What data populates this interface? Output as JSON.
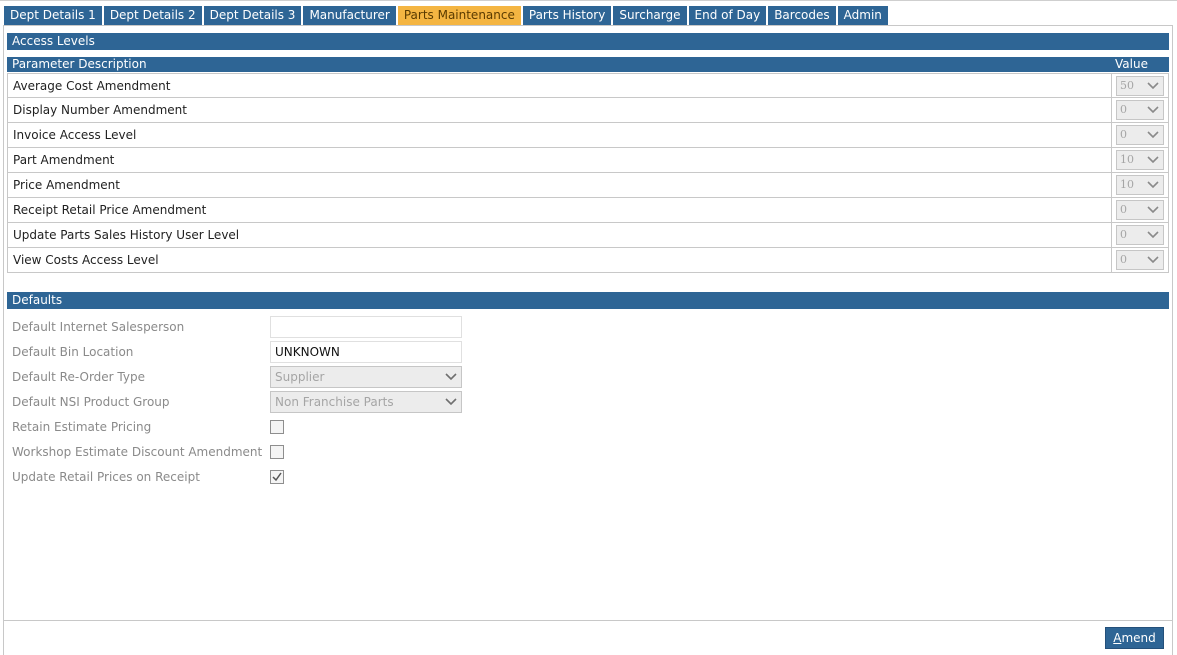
{
  "tabs": [
    {
      "label": "Dept Details 1",
      "active": false
    },
    {
      "label": "Dept Details 2",
      "active": false
    },
    {
      "label": "Dept Details 3",
      "active": false
    },
    {
      "label": "Manufacturer",
      "active": false
    },
    {
      "label": "Parts Maintenance",
      "active": true
    },
    {
      "label": "Parts History",
      "active": false
    },
    {
      "label": "Surcharge",
      "active": false
    },
    {
      "label": "End of Day",
      "active": false
    },
    {
      "label": "Barcodes",
      "active": false
    },
    {
      "label": "Admin",
      "active": false
    }
  ],
  "access_levels": {
    "title": "Access Levels",
    "columns": {
      "description": "Parameter Description",
      "value": "Value"
    },
    "rows": [
      {
        "label": "Average Cost Amendment",
        "value": "50"
      },
      {
        "label": "Display Number Amendment",
        "value": "0"
      },
      {
        "label": "Invoice Access Level",
        "value": "0"
      },
      {
        "label": "Part Amendment",
        "value": "10"
      },
      {
        "label": "Price Amendment",
        "value": "10"
      },
      {
        "label": "Receipt Retail Price Amendment",
        "value": "0"
      },
      {
        "label": "Update Parts Sales History User Level",
        "value": "0"
      },
      {
        "label": "View Costs Access Level",
        "value": "0"
      }
    ]
  },
  "defaults": {
    "title": "Defaults",
    "internet_salesperson": {
      "label": "Default Internet Salesperson",
      "value": ""
    },
    "bin_location": {
      "label": "Default Bin Location",
      "value": "UNKNOWN"
    },
    "reorder_type": {
      "label": "Default Re-Order Type",
      "value": "Supplier"
    },
    "nsi_product_group": {
      "label": "Default NSI Product Group",
      "value": "Non Franchise Parts"
    },
    "retain_estimate_pricing": {
      "label": "Retain Estimate Pricing",
      "checked": false
    },
    "workshop_estimate_discount": {
      "label": "Workshop Estimate Discount Amendment",
      "checked": false
    },
    "update_retail_prices": {
      "label": "Update Retail Prices on Receipt",
      "checked": true
    }
  },
  "actions": {
    "amend_prefix": "A",
    "amend_rest": "mend"
  },
  "colors": {
    "header_blue": "#2e6595",
    "active_tab": "#f4b542"
  },
  "icons": {
    "dropdown": "chevron-down-icon",
    "check": "check-icon"
  }
}
